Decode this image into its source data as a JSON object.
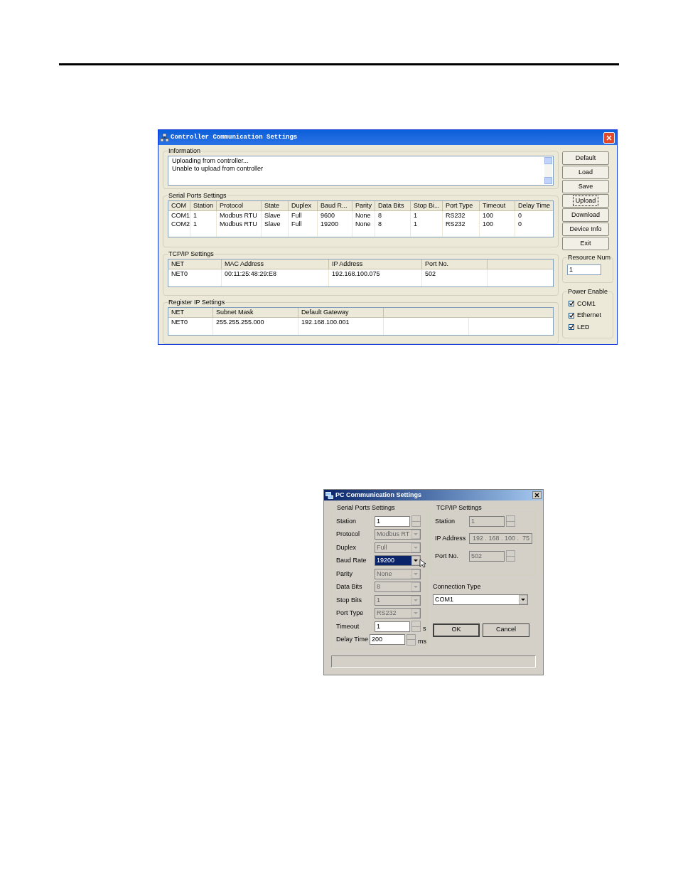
{
  "controller_dialog": {
    "title": "Controller Communication Settings",
    "information": {
      "label": "Information",
      "lines": [
        "Uploading from controller...",
        "Unable to upload from controller"
      ]
    },
    "serial_ports": {
      "label": "Serial Ports Settings",
      "columns": [
        "COM",
        "Station",
        "Protocol",
        "State",
        "Duplex",
        "Baud R...",
        "Parity",
        "Data Bits",
        "Stop Bi...",
        "Port Type",
        "Timeout",
        "Delay Time"
      ],
      "rows": [
        [
          "COM1",
          "1",
          "Modbus RTU",
          "Slave",
          "Full",
          "9600",
          "None",
          "8",
          "1",
          "RS232",
          "100",
          "0"
        ],
        [
          "COM2",
          "1",
          "Modbus RTU",
          "Slave",
          "Full",
          "19200",
          "None",
          "8",
          "1",
          "RS232",
          "100",
          "0"
        ]
      ]
    },
    "tcpip": {
      "label": "TCP/IP Settings",
      "columns": [
        "NET",
        "MAC Address",
        "IP Address",
        "Port No."
      ],
      "rows": [
        [
          "NET0",
          "00:11:25:48:29:E8",
          "192.168.100.075",
          "502"
        ]
      ]
    },
    "register_ip": {
      "label": "Register IP Settings",
      "columns": [
        "NET",
        "Subnet Mask",
        "Default Gateway"
      ],
      "rows": [
        [
          "NET0",
          "255.255.255.000",
          "192.168.100.001"
        ]
      ]
    },
    "buttons": [
      {
        "label": "Default",
        "focused": false
      },
      {
        "label": "Load",
        "focused": false
      },
      {
        "label": "Save",
        "focused": false
      },
      {
        "label": "Upload",
        "focused": true
      },
      {
        "label": "Download",
        "focused": false
      },
      {
        "label": "Device Info",
        "focused": false
      },
      {
        "label": "Exit",
        "focused": false
      }
    ],
    "resource_num": {
      "label": "Resource Num",
      "value": "1"
    },
    "power_enable": {
      "label": "Power Enable",
      "items": [
        {
          "label": "COM1",
          "checked": true
        },
        {
          "label": "Ethernet",
          "checked": true
        },
        {
          "label": "LED",
          "checked": true
        }
      ]
    }
  },
  "pc_dialog": {
    "title": "PC Communication Settings",
    "serial_ports": {
      "label": "Serial Ports Settings",
      "fields": [
        {
          "label": "Station",
          "kind": "spin",
          "value": "1",
          "disabled": false
        },
        {
          "label": "Protocol",
          "kind": "combo",
          "value": "Modbus RT",
          "disabled": true
        },
        {
          "label": "Duplex",
          "kind": "combo",
          "value": "Full",
          "disabled": true
        },
        {
          "label": "Baud Rate",
          "kind": "combo",
          "value": "19200",
          "disabled": false,
          "focused": true
        },
        {
          "label": "Parity",
          "kind": "combo",
          "value": "None",
          "disabled": true
        },
        {
          "label": "Data Bits",
          "kind": "combo",
          "value": "8",
          "disabled": true
        },
        {
          "label": "Stop Bits",
          "kind": "combo",
          "value": "1",
          "disabled": true
        },
        {
          "label": "Port Type",
          "kind": "combo",
          "value": "RS232",
          "disabled": true
        },
        {
          "label": "Timeout",
          "kind": "spin",
          "value": "1",
          "disabled": false,
          "unit": "s"
        },
        {
          "label": "Delay Time",
          "kind": "spin",
          "value": "200",
          "disabled": false,
          "unit": "ms"
        }
      ]
    },
    "tcpip": {
      "label": "TCP/IP Settings",
      "fields": [
        {
          "label": "Station",
          "kind": "spin",
          "value": "1",
          "disabled": true
        },
        {
          "label": "IP Address",
          "kind": "ip",
          "value": "192 . 168 . 100 .  75",
          "disabled": true
        },
        {
          "label": "Port No.",
          "kind": "spin",
          "value": "502",
          "disabled": true
        }
      ]
    },
    "connection_type": {
      "label": "Connection Type",
      "value": "COM1"
    },
    "buttons": [
      {
        "label": "OK",
        "default": true
      },
      {
        "label": "Cancel",
        "default": false
      }
    ]
  }
}
